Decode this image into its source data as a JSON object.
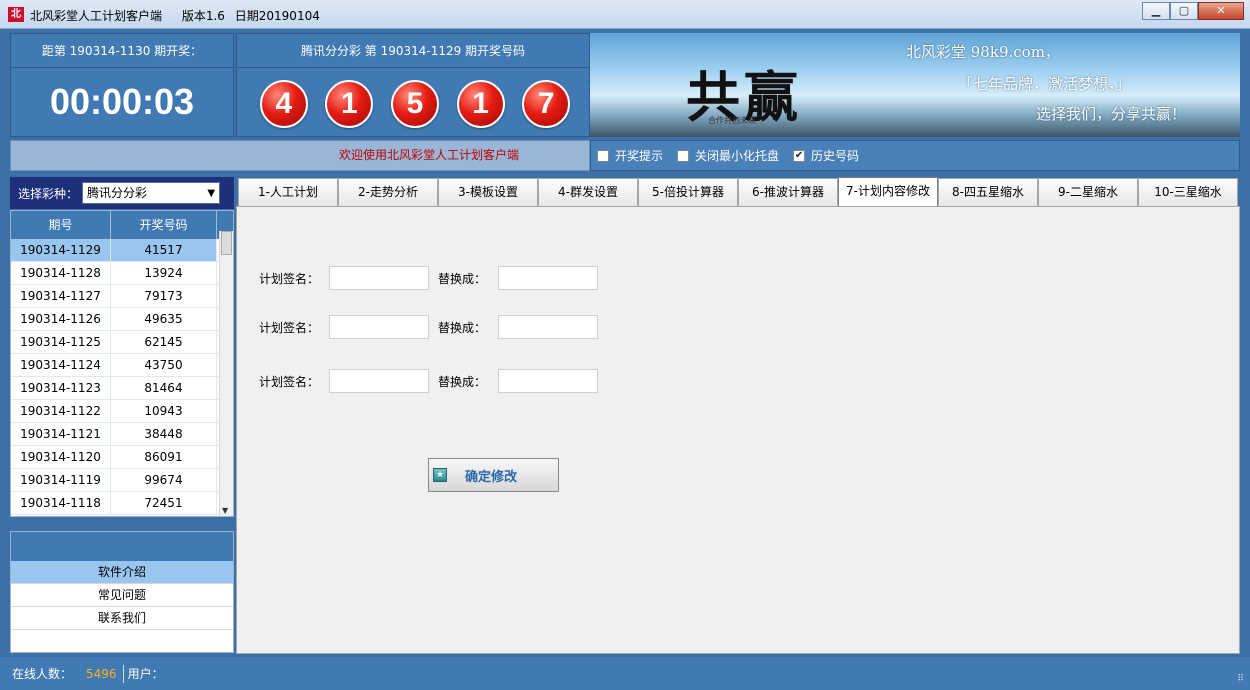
{
  "window": {
    "title": "北风彩堂人工计划客户端",
    "version": "版本1.6",
    "date": "日期20190104",
    "app_icon_text": "北"
  },
  "countdown": {
    "label": "距第 190314-1130 期开奖：",
    "time": "00:00:03"
  },
  "draw": {
    "label": "腾讯分分彩 第 190314-1129 期开奖号码",
    "balls": [
      "4",
      "1",
      "5",
      "1",
      "7"
    ]
  },
  "banner": {
    "calligraphy": "共赢",
    "subtitle": "合作共创未来",
    "line1": "北风彩堂 98k9.com，",
    "line2": "「七年品牌，激活梦想，」",
    "line3": "选择我们，分享共赢！"
  },
  "welcome": "欢迎使用北风彩堂人工计划客户端",
  "options": [
    {
      "label": "开奖提示",
      "checked": false
    },
    {
      "label": "关闭最小化托盘",
      "checked": false
    },
    {
      "label": "历史号码",
      "checked": true
    }
  ],
  "lottery_select": {
    "label": "选择彩种：",
    "value": "腾讯分分彩"
  },
  "history": {
    "headers": [
      "期号",
      "开奖号码"
    ],
    "rows": [
      [
        "190314-1129",
        "41517"
      ],
      [
        "190314-1128",
        "13924"
      ],
      [
        "190314-1127",
        "79173"
      ],
      [
        "190314-1126",
        "49635"
      ],
      [
        "190314-1125",
        "62145"
      ],
      [
        "190314-1124",
        "43750"
      ],
      [
        "190314-1123",
        "81464"
      ],
      [
        "190314-1122",
        "10943"
      ],
      [
        "190314-1121",
        "38448"
      ],
      [
        "190314-1120",
        "86091"
      ],
      [
        "190314-1119",
        "99674"
      ],
      [
        "190314-1118",
        "72451"
      ]
    ]
  },
  "left_menu": [
    "软件介绍",
    "常见问题",
    "联系我们"
  ],
  "tabs": [
    "1-人工计划",
    "2-走势分析",
    "3-模板设置",
    "4-群发设置",
    "5-倍投计算器",
    "6-推波计算器",
    "7-计划内容修改",
    "8-四五星缩水",
    "9-二星缩水",
    "10-三星缩水"
  ],
  "active_tab_index": 6,
  "form": {
    "sign_label": "计划签名：",
    "replace_label": "替换成：",
    "rows": [
      {
        "sign_value": "",
        "replace_value": ""
      },
      {
        "sign_value": "",
        "replace_value": ""
      },
      {
        "sign_value": "",
        "replace_value": ""
      }
    ],
    "confirm_label": "确定修改"
  },
  "status": {
    "online_label": "在线人数：",
    "online_count": "5496",
    "user_label": "用户："
  }
}
